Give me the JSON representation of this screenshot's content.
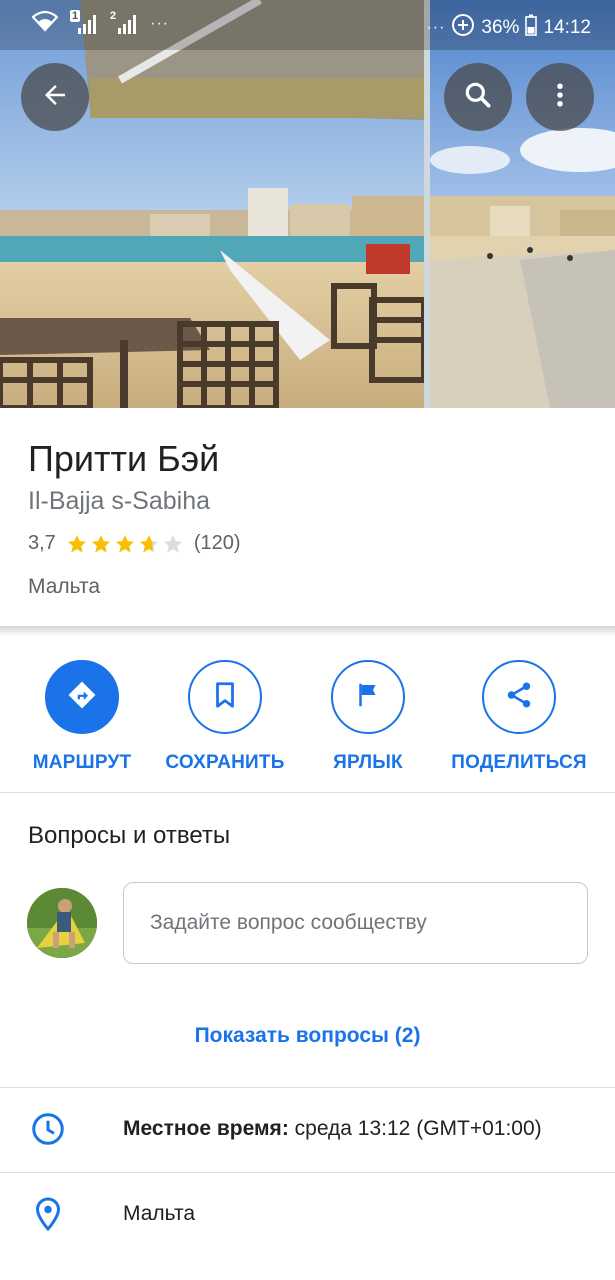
{
  "status_bar": {
    "battery": "36%",
    "time": "14:12",
    "sim1": "1",
    "sim2": "2",
    "dots": "···"
  },
  "place": {
    "title": "Притти Бэй",
    "subtitle": "Il-Bajja s-Sabiha",
    "rating": "3,7",
    "rating_stars": 3.7,
    "review_count": "(120)",
    "region": "Мальта"
  },
  "actions": [
    {
      "label": "МАРШРУТ",
      "icon": "directions-icon"
    },
    {
      "label": "СОХРАНИТЬ",
      "icon": "bookmark-icon"
    },
    {
      "label": "ЯРЛЫК",
      "icon": "flag-icon"
    },
    {
      "label": "ПОДЕЛИТЬСЯ",
      "icon": "share-icon"
    }
  ],
  "qa": {
    "heading": "Вопросы и ответы",
    "input_placeholder": "Задайте вопрос сообществу",
    "show_questions": "Показать вопросы (2)"
  },
  "info": {
    "local_time_label": "Местное время:",
    "local_time_value": " среда 13:12 (GMT+01:00)",
    "location": "Мальта"
  },
  "colors": {
    "accent": "#1a73e8",
    "star": "#fbbc04",
    "star_empty": "#dadce0"
  }
}
